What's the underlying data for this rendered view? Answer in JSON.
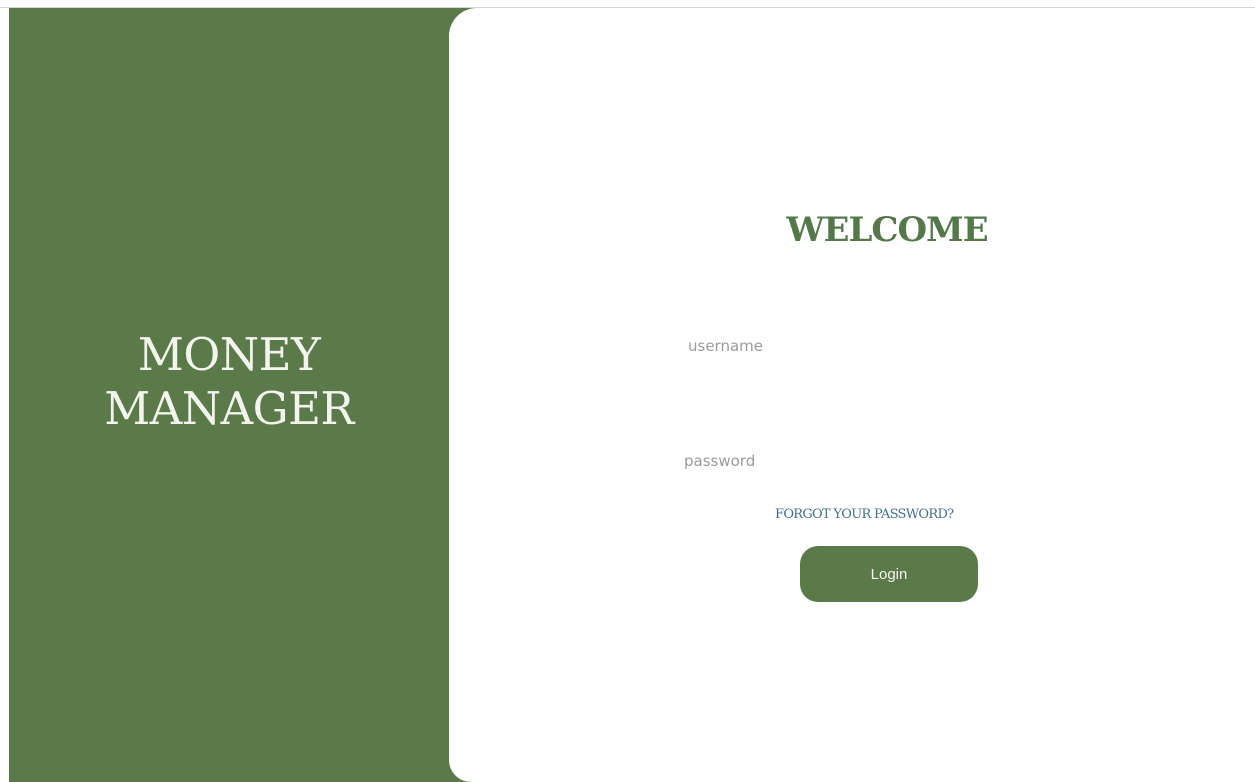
{
  "branding": {
    "line1": "MONEY",
    "line2": "MANAGER"
  },
  "form": {
    "title": "WELCOME",
    "username_placeholder": "username",
    "username_value": "",
    "password_placeholder": "password",
    "password_value": "",
    "forgot_link": "FORGOT YOUR PASSWORD?",
    "login_label": "Login"
  },
  "colors": {
    "brand_green": "#5b7a49",
    "link_blue": "#466f8e",
    "placeholder_gray": "#9b9b9b"
  }
}
